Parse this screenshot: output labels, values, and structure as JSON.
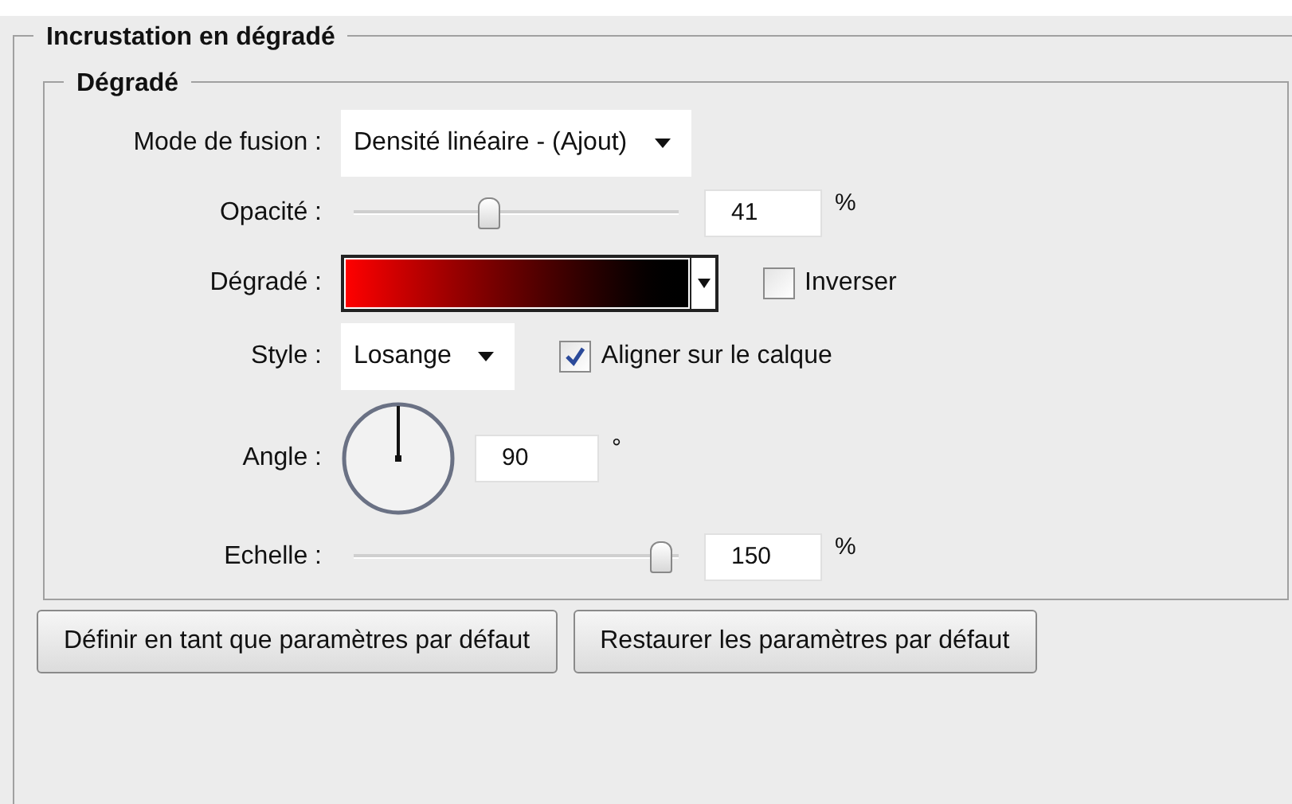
{
  "panel": {
    "title": "Incrustation en dégradé"
  },
  "group": {
    "title": "Dégradé"
  },
  "rows": [
    {
      "kind": "select",
      "label": "Mode de fusion :",
      "value": "Densité linéaire - (Ajout)"
    },
    {
      "kind": "slider",
      "label": "Opacité :",
      "level": 0.41,
      "value": "41",
      "unit": "%"
    },
    {
      "kind": "gradient",
      "label": "Dégradé :",
      "checkbox": {
        "label": "Inverser",
        "checked": false
      }
    },
    {
      "kind": "select",
      "label": "Style :",
      "value": "Losange",
      "checkbox": {
        "label": "Aligner sur le calque",
        "checked": true
      }
    },
    {
      "kind": "angle",
      "label": "Angle :",
      "value": "90",
      "unit": "°"
    },
    {
      "kind": "slider",
      "label": "Echelle :",
      "level": 0.98,
      "value": "150",
      "unit": "%"
    }
  ],
  "buttons": [
    "Définir en tant que paramètres par défaut",
    "Restaurer les paramètres par défaut"
  ]
}
